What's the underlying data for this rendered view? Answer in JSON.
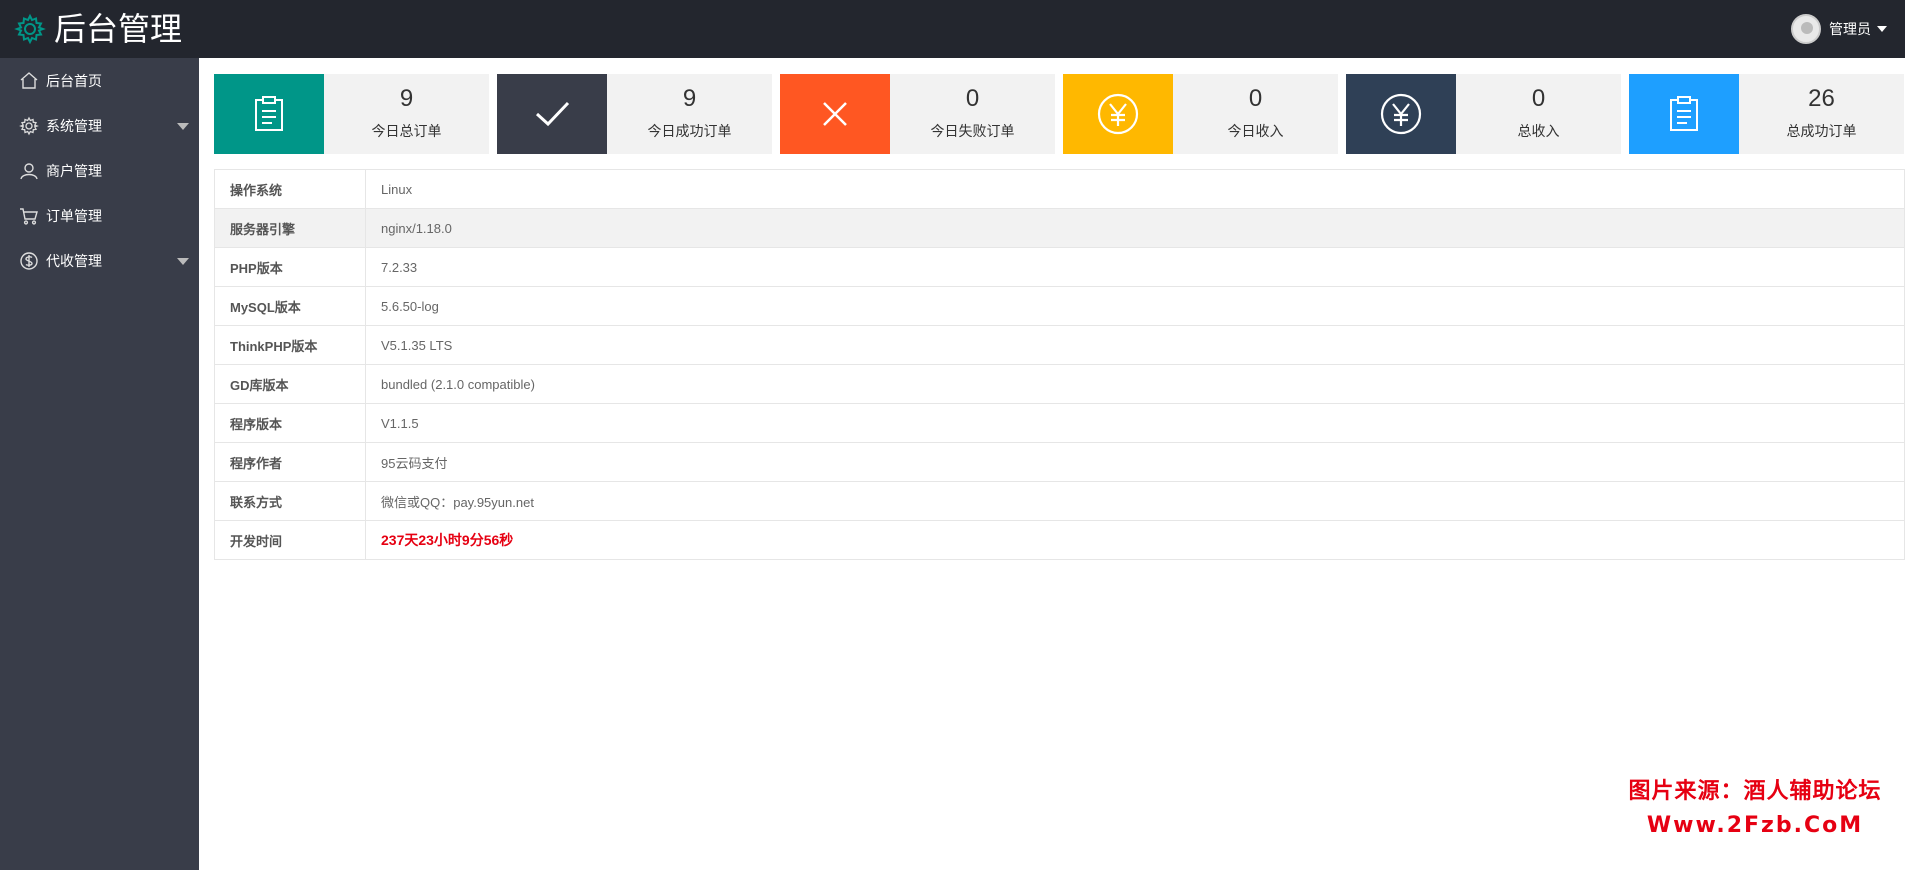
{
  "app": {
    "title": "后台管理",
    "logo_icon": "gear-icon",
    "accent": "#009688"
  },
  "user": {
    "name": "管理员",
    "avatar_icon": "avatar-icon"
  },
  "sidebar": {
    "items": [
      {
        "label": "后台首页",
        "icon": "home-icon",
        "has_submenu": false
      },
      {
        "label": "系统管理",
        "icon": "gear-icon",
        "has_submenu": true
      },
      {
        "label": "商户管理",
        "icon": "user-icon",
        "has_submenu": false
      },
      {
        "label": "订单管理",
        "icon": "cart-icon",
        "has_submenu": false
      },
      {
        "label": "代收管理",
        "icon": "dollar-icon",
        "has_submenu": true
      }
    ]
  },
  "stats": [
    {
      "value": "9",
      "label": "今日总订单",
      "icon": "clipboard-icon",
      "color": "#009688"
    },
    {
      "value": "9",
      "label": "今日成功订单",
      "icon": "check-icon",
      "color": "#393d49"
    },
    {
      "value": "0",
      "label": "今日失败订单",
      "icon": "close-icon",
      "color": "#ff5722"
    },
    {
      "value": "0",
      "label": "今日收入",
      "icon": "yen-icon",
      "color": "#ffb800"
    },
    {
      "value": "0",
      "label": "总收入",
      "icon": "yen-icon",
      "color": "#2f4056"
    },
    {
      "value": "26",
      "label": "总成功订单",
      "icon": "clipboard-icon",
      "color": "#1e9fff"
    }
  ],
  "system_info": [
    {
      "key": "操作系统",
      "value": "Linux"
    },
    {
      "key": "服务器引擎",
      "value": "nginx/1.18.0"
    },
    {
      "key": "PHP版本",
      "value": "7.2.33"
    },
    {
      "key": "MySQL版本",
      "value": "5.6.50-log"
    },
    {
      "key": "ThinkPHP版本",
      "value": "V5.1.35 LTS"
    },
    {
      "key": "GD库版本",
      "value": "bundled (2.1.0 compatible)"
    },
    {
      "key": "程序版本",
      "value": "V1.1.5"
    },
    {
      "key": "程序作者",
      "value": "95云码支付"
    },
    {
      "key": "联系方式",
      "value": "微信或QQ：pay.95yun.net"
    },
    {
      "key": "开发时间",
      "value": "237天23小时9分56秒"
    }
  ],
  "watermark": {
    "line1": "图片来源：酒人辅助论坛",
    "line2": "Www.2Fzb.CoM"
  }
}
